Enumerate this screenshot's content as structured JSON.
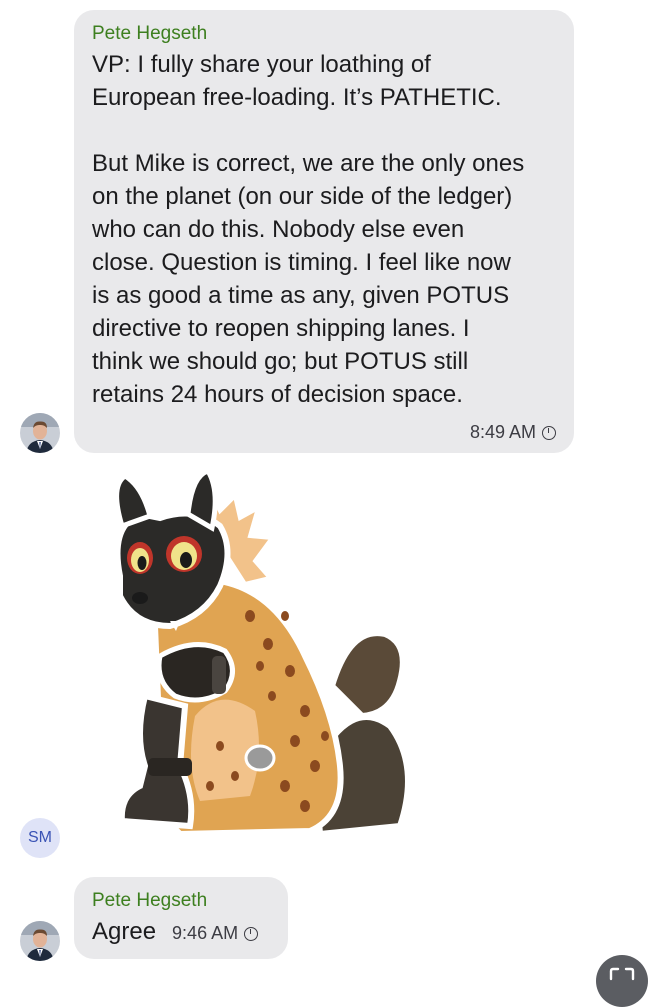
{
  "messages": [
    {
      "sender": "Pete Hegseth",
      "text": "VP: I fully share your loathing of\nEuropean free-loading. It’s PATHETIC.\n\nBut Mike is correct, we are the only ones\non the planet (on our side of the ledger)\nwho can do this. Nobody else even\nclose. Question is timing. I feel like now\nis as good a time as any, given POTUS\ndirective to reopen shipping lanes. I\nthink we should go; but POTUS still\nretains 24 hours of decision space.",
      "time": "8:49 AM"
    },
    {
      "sender": "Pete Hegseth",
      "text": "Agree",
      "time": "9:46 AM"
    }
  ],
  "sticker_sender_initials": "SM",
  "icons": {
    "status": "clock-icon",
    "sticker": "hyena-sticker",
    "scroll": "expand-icon"
  },
  "colors": {
    "sender_name": "#3d7f1f",
    "bubble": "#e9e9eb",
    "initials_bg": "#dfe3f7",
    "initials_text": "#3a53b5"
  }
}
